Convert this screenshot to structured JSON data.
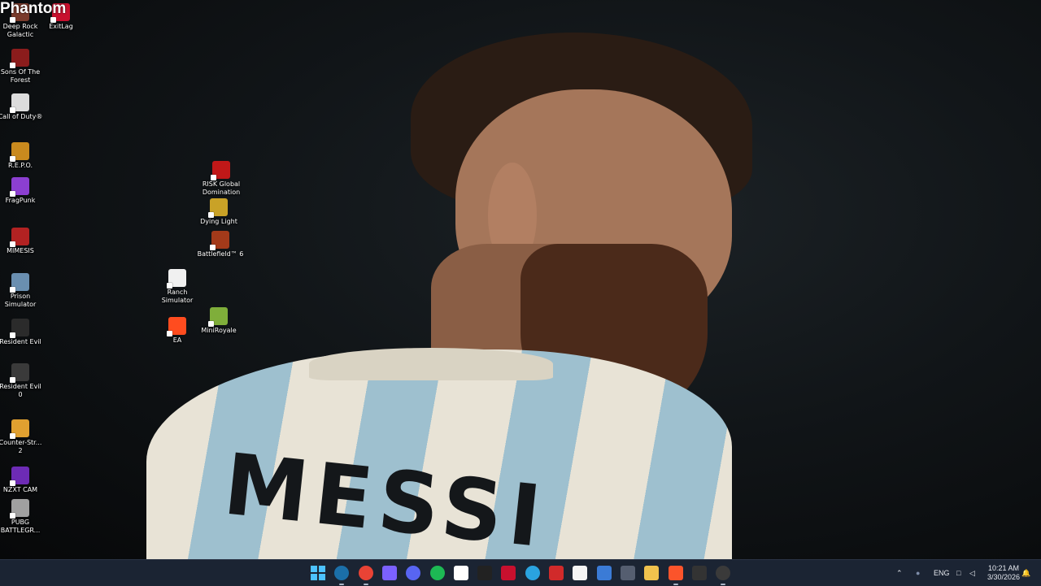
{
  "desktop": {
    "overlay_logo": "Phantom",
    "icons": [
      {
        "label": "Deep Rock Galactic",
        "color": "#7a3b2b",
        "icon": "deep-rock-galactic-icon"
      },
      {
        "label": "ExitLag",
        "color": "#c8102e",
        "icon": "exitlag-icon"
      },
      {
        "label": "Sons Of The Forest",
        "color": "#8b1c1c",
        "icon": "sons-of-the-forest-icon"
      },
      {
        "label": "Call of Duty®",
        "color": "#dcdcdc",
        "icon": "call-of-duty-icon"
      },
      {
        "label": "R.E.P.O.",
        "color": "#c98a1e",
        "icon": "repo-icon"
      },
      {
        "label": "FragPunk",
        "color": "#8c3fd1",
        "icon": "fragpunk-icon"
      },
      {
        "label": "MIMESIS",
        "color": "#b22222",
        "icon": "mimesis-icon"
      },
      {
        "label": "Prison Simulator",
        "color": "#6a8fb0",
        "icon": "prison-simulator-icon"
      },
      {
        "label": "Resident Evil",
        "color": "#2b2b2b",
        "icon": "resident-evil-icon"
      },
      {
        "label": "Resident Evil 0",
        "color": "#3a3a3a",
        "icon": "resident-evil-0-icon"
      },
      {
        "label": "Counter-Str... 2",
        "color": "#e0a030",
        "icon": "counter-strike-2-icon"
      },
      {
        "label": "NZXT CAM",
        "color": "#6d2bb5",
        "icon": "nzxt-cam-icon"
      },
      {
        "label": "PUBG BATTLEGR...",
        "color": "#a0a0a0",
        "icon": "pubg-icon"
      },
      {
        "label": "RISK Global Domination",
        "color": "#c01818",
        "icon": "risk-icon"
      },
      {
        "label": "Dying Light",
        "color": "#c9a227",
        "icon": "dying-light-icon"
      },
      {
        "label": "Battlefield™ 6",
        "color": "#a33a1a",
        "icon": "battlefield-6-icon"
      },
      {
        "label": "Ranch Simulator",
        "color": "#f0f0f0",
        "icon": "ranch-simulator-icon"
      },
      {
        "label": "MiniRoyale",
        "color": "#7fae3a",
        "icon": "miniroyale-icon"
      },
      {
        "label": "EA",
        "color": "#ff4c1f",
        "icon": "ea-icon"
      }
    ],
    "wallpaper_text": "MESSI"
  },
  "taskbar": {
    "apps": [
      {
        "name": "start-button",
        "color": "#4cc2ff"
      },
      {
        "name": "steam-icon",
        "color": "#1b6fa8",
        "active": true
      },
      {
        "name": "chrome-icon",
        "color": "#e94335",
        "active": true
      },
      {
        "name": "app-colorful-icon",
        "color": "#7b61ff"
      },
      {
        "name": "discord-icon",
        "color": "#5865f2"
      },
      {
        "name": "spotify-icon",
        "color": "#1db954"
      },
      {
        "name": "steelseries-icon",
        "color": "#ffffff"
      },
      {
        "name": "app-dark-icon",
        "color": "#222222"
      },
      {
        "name": "x-app-icon",
        "color": "#c8102e"
      },
      {
        "name": "telegram-icon",
        "color": "#2aa3e0"
      },
      {
        "name": "acrobat-icon",
        "color": "#d12a2a"
      },
      {
        "name": "notepad-icon",
        "color": "#f5f5f5"
      },
      {
        "name": "shield-app-icon",
        "color": "#3b7bd6"
      },
      {
        "name": "settings-gear-icon",
        "color": "#555e70"
      },
      {
        "name": "file-explorer-icon",
        "color": "#f0c24d"
      },
      {
        "name": "brave-icon",
        "color": "#fb542b",
        "active": true
      },
      {
        "name": "app-bm-icon",
        "color": "#333333"
      },
      {
        "name": "obs-icon",
        "color": "#3a3a3a",
        "active": true
      }
    ],
    "tray": {
      "language": "ENG",
      "time": "10:21 AM",
      "date": "3/30/2026"
    }
  }
}
